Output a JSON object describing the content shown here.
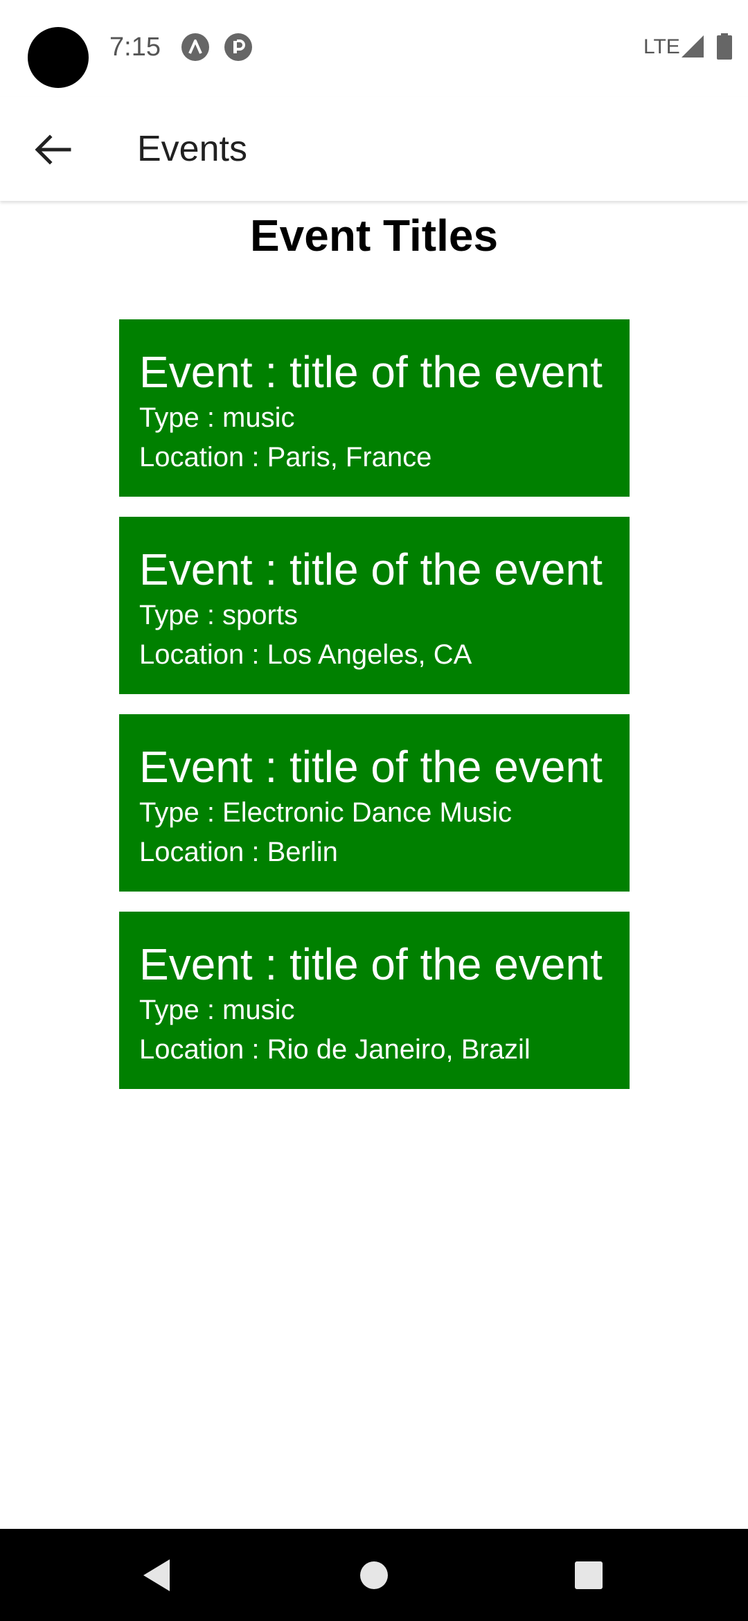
{
  "status_bar": {
    "time": "7:15",
    "network": "LTE",
    "icons": [
      "camera-cutout",
      "notification-a-icon",
      "notification-p-icon",
      "signal-icon",
      "battery-icon"
    ]
  },
  "app_bar": {
    "title": "Events",
    "back_icon": "arrow-left-icon"
  },
  "page": {
    "heading": "Event Titles"
  },
  "events": [
    {
      "title": "Event : title of the event",
      "type": "Type : music",
      "location": "Location : Paris, France"
    },
    {
      "title": "Event : title of the event",
      "type": "Type : sports",
      "location": "Location : Los Angeles, CA"
    },
    {
      "title": "Event : title of the event",
      "type": "Type : Electronic Dance Music",
      "location": "Location : Berlin"
    },
    {
      "title": "Event : title of the event",
      "type": "Type : music",
      "location": "Location : Rio de Janeiro, Brazil"
    }
  ],
  "nav_bar": {
    "icons": [
      "back-triangle-icon",
      "home-circle-icon",
      "recents-square-icon"
    ]
  },
  "colors": {
    "card_background": "#008000",
    "card_text": "#ffffff",
    "nav_background": "#000000"
  }
}
